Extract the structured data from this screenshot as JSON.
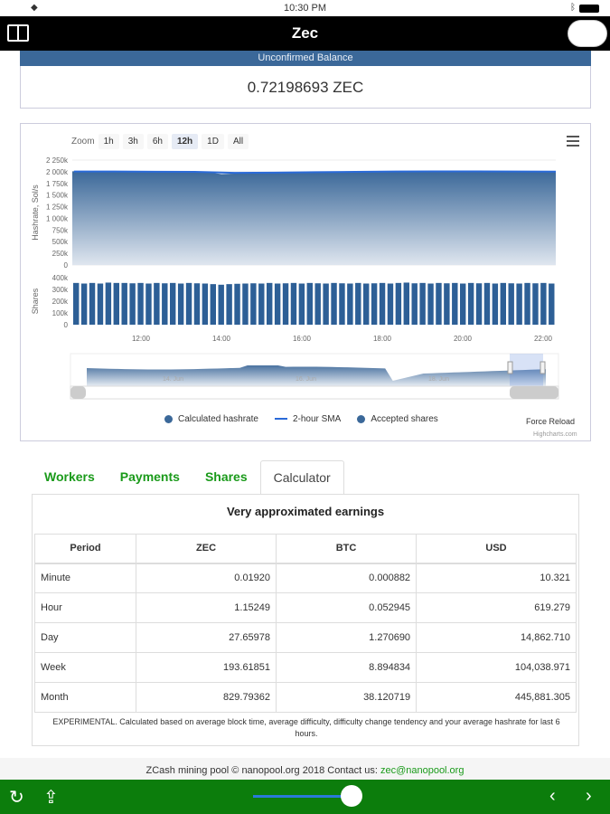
{
  "status": {
    "time": "10:30 PM"
  },
  "nav": {
    "title": "Zec"
  },
  "balance": {
    "header": "Unconfirmed Balance",
    "value": "0.72198693 ZEC"
  },
  "chart_zoom": {
    "label": "Zoom",
    "buttons": [
      "1h",
      "3h",
      "6h",
      "12h",
      "1D",
      "All"
    ],
    "active": "12h"
  },
  "chart_data": [
    {
      "type": "area",
      "title": "",
      "ylabel": "Hashrate, Sol/s",
      "ylim": [
        0,
        2250
      ],
      "yunit": "k",
      "yticks": [
        "0",
        "250k",
        "500k",
        "750k",
        "1 000k",
        "1 250k",
        "1 500k",
        "1 750k",
        "2 000k",
        "2 250k"
      ],
      "xticks": [
        "12:00",
        "14:00",
        "16:00",
        "18:00",
        "20:00",
        "22:00"
      ],
      "series": [
        {
          "name": "Calculated hashrate",
          "color": "#3b6899",
          "x": [
            "10:20",
            "10:40",
            "11:00",
            "11:20",
            "11:40",
            "12:00",
            "12:20",
            "12:40",
            "13:00",
            "13:20",
            "13:40",
            "14:00",
            "14:20",
            "14:40",
            "15:00",
            "15:20",
            "15:40",
            "16:00",
            "16:20",
            "16:40",
            "17:00",
            "17:20",
            "17:40",
            "18:00",
            "18:20",
            "18:40",
            "19:00",
            "19:20",
            "19:40",
            "20:00",
            "20:20",
            "20:40",
            "21:00",
            "21:20",
            "21:40",
            "22:00",
            "22:20"
          ],
          "values": [
            2010,
            2000,
            2010,
            2005,
            2000,
            2000,
            1995,
            2000,
            1995,
            2000,
            1990,
            1950,
            1960,
            1970,
            1975,
            1980,
            1985,
            1990,
            1995,
            1990,
            2000,
            1995,
            2005,
            2000,
            2010,
            2005,
            2000,
            2010,
            2015,
            2005,
            2010,
            2000,
            2010,
            2005,
            2000,
            2010,
            2000
          ]
        },
        {
          "name": "2-hour SMA",
          "color": "#2a6ad8",
          "x": [
            "10:20",
            "11:20",
            "12:20",
            "13:20",
            "14:20",
            "15:20",
            "16:20",
            "17:20",
            "18:20",
            "19:20",
            "20:20",
            "21:20",
            "22:20"
          ],
          "values": [
            2005,
            2005,
            2000,
            1998,
            1975,
            1980,
            1990,
            1998,
            2005,
            2008,
            2008,
            2005,
            2003
          ]
        }
      ],
      "legend": "bottom"
    },
    {
      "type": "bar",
      "ylabel": "Shares",
      "ylim": [
        0,
        400
      ],
      "yticks": [
        "0",
        "100k",
        "200k",
        "300k",
        "400k"
      ],
      "series": [
        {
          "name": "Accepted shares",
          "color": "#2d5f96",
          "values": [
            355,
            350,
            355,
            350,
            358,
            355,
            355,
            352,
            355,
            350,
            355,
            352,
            355,
            350,
            355,
            352,
            350,
            345,
            340,
            345,
            348,
            350,
            352,
            350,
            355,
            350,
            352,
            355,
            350,
            355,
            352,
            350,
            355,
            352,
            350,
            355,
            350,
            352,
            355,
            350,
            355,
            358,
            352,
            355,
            350,
            355,
            352,
            355,
            350,
            355,
            352,
            355,
            350,
            355,
            352,
            350,
            355,
            352,
            355,
            350
          ]
        }
      ]
    },
    {
      "type": "area",
      "role": "navigator",
      "xticks": [
        "14. Jun",
        "16. Jun",
        "18. Jun"
      ]
    }
  ],
  "chart_footer": {
    "force_reload": "Force Reload",
    "credit": "Highcharts.com"
  },
  "tabs": [
    {
      "label": "Workers"
    },
    {
      "label": "Payments"
    },
    {
      "label": "Shares"
    },
    {
      "label": "Calculator"
    }
  ],
  "calculator": {
    "title": "Very approximated earnings",
    "headers": [
      "Period",
      "ZEC",
      "BTC",
      "USD"
    ],
    "rows": [
      [
        "Minute",
        "0.01920",
        "0.000882",
        "10.321"
      ],
      [
        "Hour",
        "1.15249",
        "0.052945",
        "619.279"
      ],
      [
        "Day",
        "27.65978",
        "1.270690",
        "14,862.710"
      ],
      [
        "Week",
        "193.61851",
        "8.894834",
        "104,038.971"
      ],
      [
        "Month",
        "829.79362",
        "38.120719",
        "445,881.305"
      ]
    ],
    "note": "EXPERIMENTAL. Calculated based on average block time, average difficulty, difficulty change tendency and your average hashrate for last 6 hours."
  },
  "footer": {
    "text": "ZCash mining pool © nanopool.org 2018 Contact us: ",
    "email": "zec@nanopool.org"
  }
}
